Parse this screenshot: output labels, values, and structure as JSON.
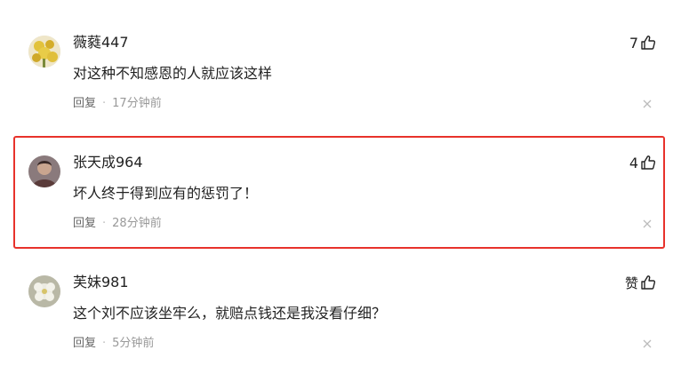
{
  "comments": [
    {
      "username": "薇蕤447",
      "content": "对这种不知感恩的人就应该这样",
      "reply_label": "回复",
      "separator": "·",
      "time": "17分钟前",
      "like_count": "7",
      "avatar_icon": "yellow-flowers-avatar",
      "avatar_color": "#d9b93a"
    },
    {
      "username": "张天成964",
      "content": "坏人终于得到应有的惩罚了！",
      "reply_label": "回复",
      "separator": "·",
      "time": "28分钟前",
      "like_count": "4",
      "avatar_icon": "portrait-avatar",
      "avatar_color": "#6b4f4a"
    },
    {
      "username": "芙妹981",
      "content": "这个刘不应该坐牢么，就赔点钱还是我没看仔细？",
      "reply_label": "回复",
      "separator": "·",
      "time": "5分钟前",
      "like_count": "赞",
      "avatar_icon": "white-flower-avatar",
      "avatar_color": "#c9c7b5"
    }
  ],
  "highlight_color": "#e8322b"
}
